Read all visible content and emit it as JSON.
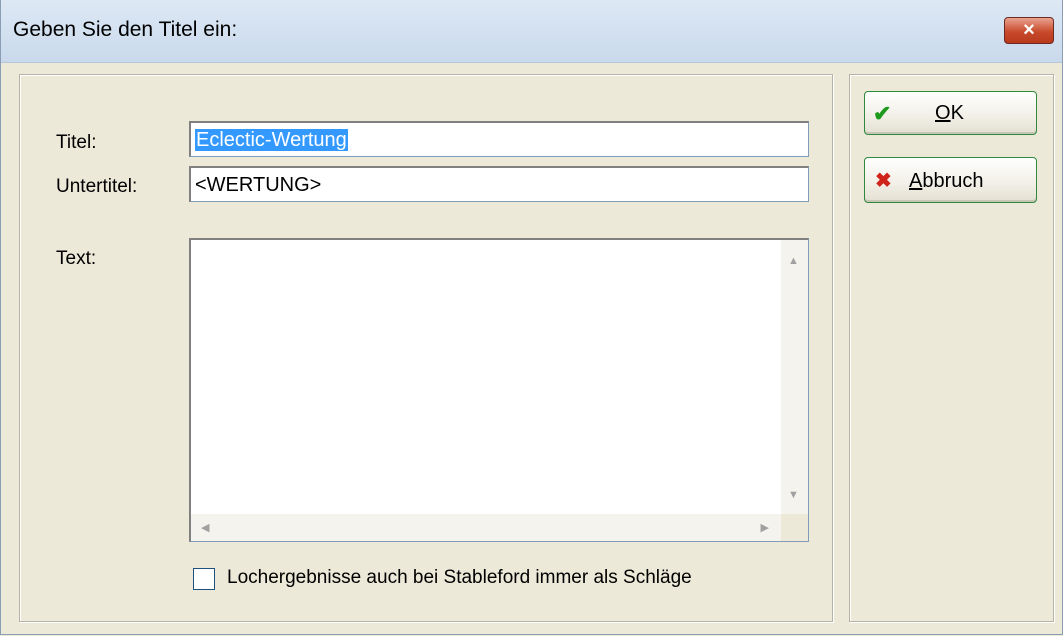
{
  "window": {
    "title": "Geben Sie den Titel ein:",
    "close_glyph": "×"
  },
  "form": {
    "titel_label": "Titel:",
    "titel_value": "Eclectic-Wertung",
    "untertitel_label": "Untertitel:",
    "untertitel_value": "<WERTUNG>",
    "text_label": "Text:",
    "text_value": "",
    "checkbox_label": "Lochergebnisse auch bei Stableford immer als Schläge",
    "checkbox_checked": false
  },
  "buttons": {
    "ok": {
      "mnemonic": "O",
      "rest": "K",
      "icon": "check-icon"
    },
    "cancel": {
      "mnemonic": "A",
      "rest": "bbruch",
      "icon": "x-icon"
    }
  },
  "icons": {
    "check_glyph": "✔",
    "x_glyph": "✖",
    "up_glyph": "▲",
    "down_glyph": "▼",
    "left_glyph": "◀",
    "right_glyph": "▶"
  },
  "colors": {
    "selection": "#3399ff",
    "ok_icon": "#1e9a1e",
    "cancel_icon": "#d0241b"
  }
}
